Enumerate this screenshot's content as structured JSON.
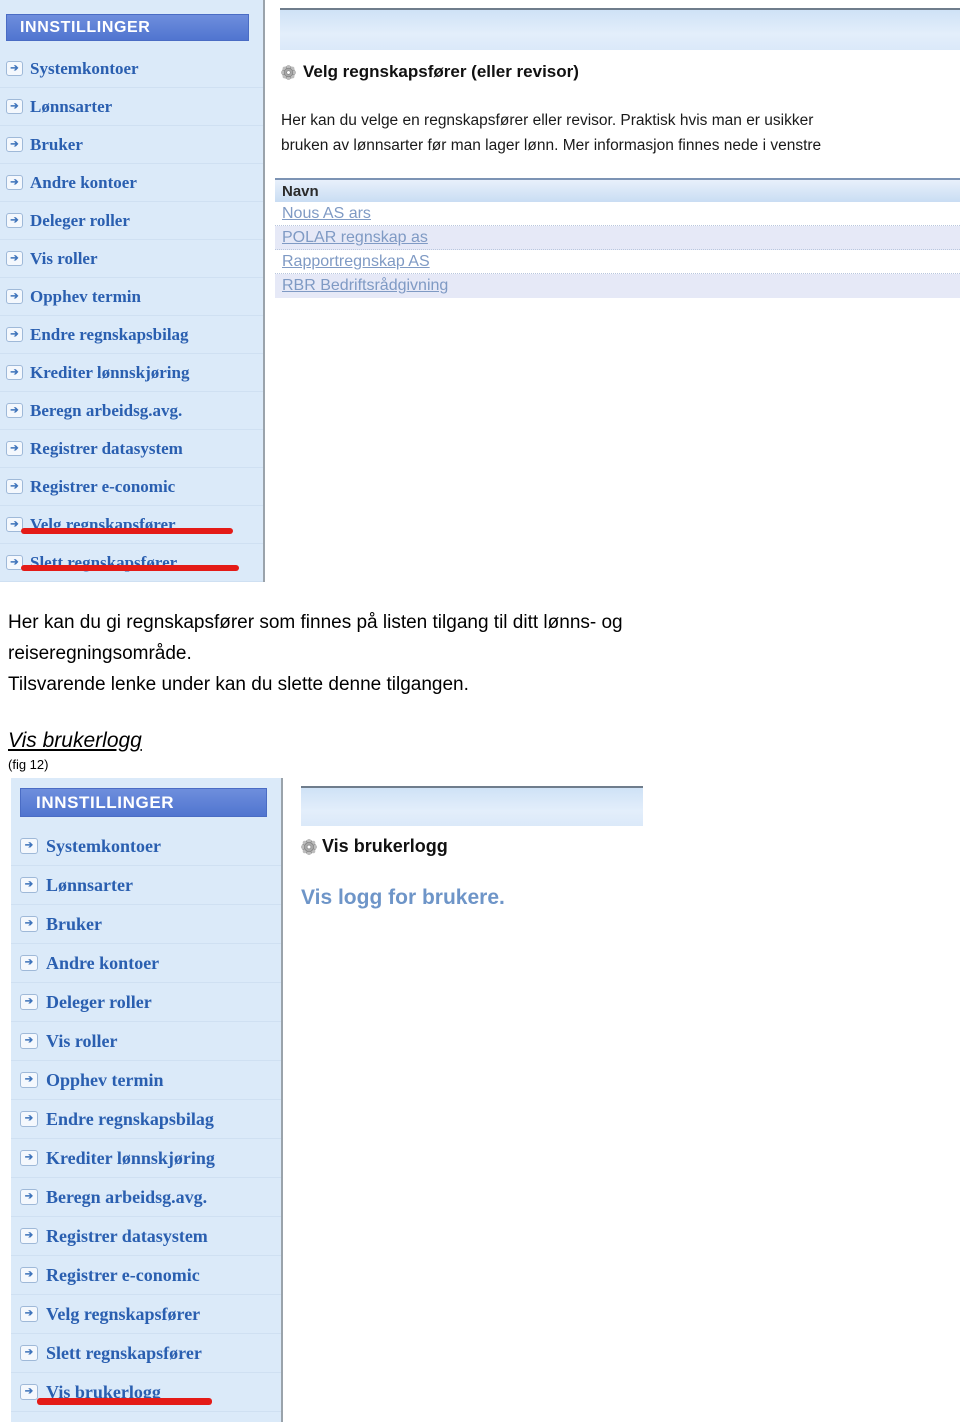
{
  "figure1": {
    "sidebar": {
      "title": "INNSTILLINGER",
      "icon": "arrow-right-icon",
      "items": [
        {
          "label": "Systemkontoer"
        },
        {
          "label": "Lønnsarter"
        },
        {
          "label": "Bruker"
        },
        {
          "label": "Andre kontoer"
        },
        {
          "label": "Deleger roller"
        },
        {
          "label": "Vis roller"
        },
        {
          "label": "Opphev termin"
        },
        {
          "label": "Endre regnskapsbilag"
        },
        {
          "label": "Krediter lønnskjøring"
        },
        {
          "label": "Beregn arbeidsg.avg."
        },
        {
          "label": "Registrer datasystem"
        },
        {
          "label": "Registrer e-conomic"
        },
        {
          "label": "Velg regnskapsfører"
        },
        {
          "label": "Slett regnskapsfører"
        }
      ],
      "highlight_color": "#e41b17",
      "highlighted_items": [
        "Velg regnskapsfører",
        "Slett regnskapsfører"
      ]
    },
    "content": {
      "gear_icon": "gear-icon",
      "heading": "Velg regnskapsfører (eller revisor)",
      "paragraph_line1": "Her kan du velge en regnskapsfører eller revisor. Praktisk hvis man er usikker",
      "paragraph_line2": "bruken av lønnsarter før man lager lønn. Mer informasjon finnes nede i venstre",
      "table": {
        "columns": [
          "Navn"
        ],
        "rows": [
          [
            "Nous AS ars"
          ],
          [
            "POLAR regnskap as"
          ],
          [
            "Rapportregnskap AS"
          ],
          [
            "RBR Bedriftsrådgivning"
          ]
        ]
      }
    }
  },
  "body": {
    "line1": "Her kan du gi regnskapsfører som finnes på listen tilgang til ditt lønns- og",
    "line2": "reiseregningsområde.",
    "line3": "Tilsvarende lenke under kan du slette denne tilgangen."
  },
  "section": {
    "heading": "Vis brukerlogg",
    "figure_caption": "(fig 12)"
  },
  "figure2": {
    "sidebar": {
      "title": "INNSTILLINGER",
      "icon": "arrow-right-icon",
      "items": [
        {
          "label": "Systemkontoer"
        },
        {
          "label": "Lønnsarter"
        },
        {
          "label": "Bruker"
        },
        {
          "label": "Andre kontoer"
        },
        {
          "label": "Deleger roller"
        },
        {
          "label": "Vis roller"
        },
        {
          "label": "Opphev termin"
        },
        {
          "label": "Endre regnskapsbilag"
        },
        {
          "label": "Krediter lønnskjøring"
        },
        {
          "label": "Beregn arbeidsg.avg."
        },
        {
          "label": "Registrer datasystem"
        },
        {
          "label": "Registrer e-conomic"
        },
        {
          "label": "Velg regnskapsfører"
        },
        {
          "label": "Slett regnskapsfører"
        },
        {
          "label": "Vis brukerlogg"
        }
      ],
      "highlight_color": "#e41b17",
      "highlighted_items": [
        "Vis brukerlogg"
      ]
    },
    "content": {
      "gear_icon": "gear-icon",
      "heading": "Vis brukerlogg",
      "paragraph": "Vis logg for brukere."
    }
  }
}
